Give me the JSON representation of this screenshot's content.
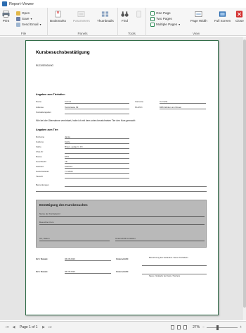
{
  "window": {
    "title": "Report-Viewer"
  },
  "ribbon": {
    "print": "Print",
    "open": "Open",
    "save": "Save",
    "send_email": "Send Email",
    "file_group": "File",
    "bookmarks": "Bookmarks",
    "parameters": "Parameters",
    "thumbnails": "Thumbnails",
    "panels_group": "Panels",
    "find": "Find",
    "tools_group": "Tools",
    "one_page": "One Page",
    "two_pages": "Two Pages",
    "multiple_pages": "Multiple Pages",
    "page_width": "Page Width",
    "full_screen": "Full Screen",
    "close": "Close",
    "view_group": "View"
  },
  "document": {
    "title": "Kursbesuchsbestätigung",
    "subtitle": "RÜCKSENDUNG",
    "section_owner": "Angaben zum Tierhalter:",
    "owner_name_label": "Name",
    "owner_name_value": "Tunnel",
    "owner_firstname_label": "Vorname",
    "owner_firstname_value": "Cornelia",
    "owner_address_label": "Adresse",
    "owner_address_value": "Teststrasse 99",
    "owner_city_label": "PLZ/Ort",
    "owner_city_value": "8484 Ebikon am Rosen",
    "owner_contact_label": "Kontaktangaben",
    "statement": "Wie bei der Übernahme vereinbart, habe ich mit dem unten bezeichneten Tier den Kurs gemacht:",
    "section_animal": "Angaben zum Tier:",
    "animal_rows": [
      {
        "label": "Rufname",
        "value": "Jamie"
      },
      {
        "label": "Gattung",
        "value": "Katze"
      },
      {
        "label": "Farbe",
        "value": "Braun, getigert, 4/4"
      },
      {
        "label": "Chip-Nr",
        "value": ""
      },
      {
        "label": "Rasse",
        "value": "EKH"
      },
      {
        "label": "Geschlecht",
        "value": "mk"
      },
      {
        "label": "Kastriert",
        "value": "Kastriert"
      },
      {
        "label": "Geburtsdatum",
        "value": "7.6.2022"
      },
      {
        "label": "Tierarzt",
        "value": ""
      },
      {
        "label": "Bemerkungen",
        "value": ""
      }
    ],
    "confirm_title": "Bestätigung des Kursbesuches",
    "course_leader_label": "Name der Kursleiterin/",
    "course_visited_label": "Besuchter Kurs",
    "course_place_date_label": "Ort, Datum",
    "course_signature_label": "Unterschrift Kursleiter",
    "sig_rows": [
      {
        "label": "Ort / Datum:",
        "value": "06.08.2023",
        "sig_label": "Unterschrift:",
        "note": "Bezeichnung des Verkaufers / Name Tierhalterin"
      },
      {
        "label": "Ort / Datum:",
        "value": "06.08.2023",
        "sig_label": "Unterschrift:",
        "note": "Name / Verkäufer der Katze / Tierheim"
      }
    ]
  },
  "statusbar": {
    "page": "Page 1 of 1",
    "zoom": "27%"
  }
}
